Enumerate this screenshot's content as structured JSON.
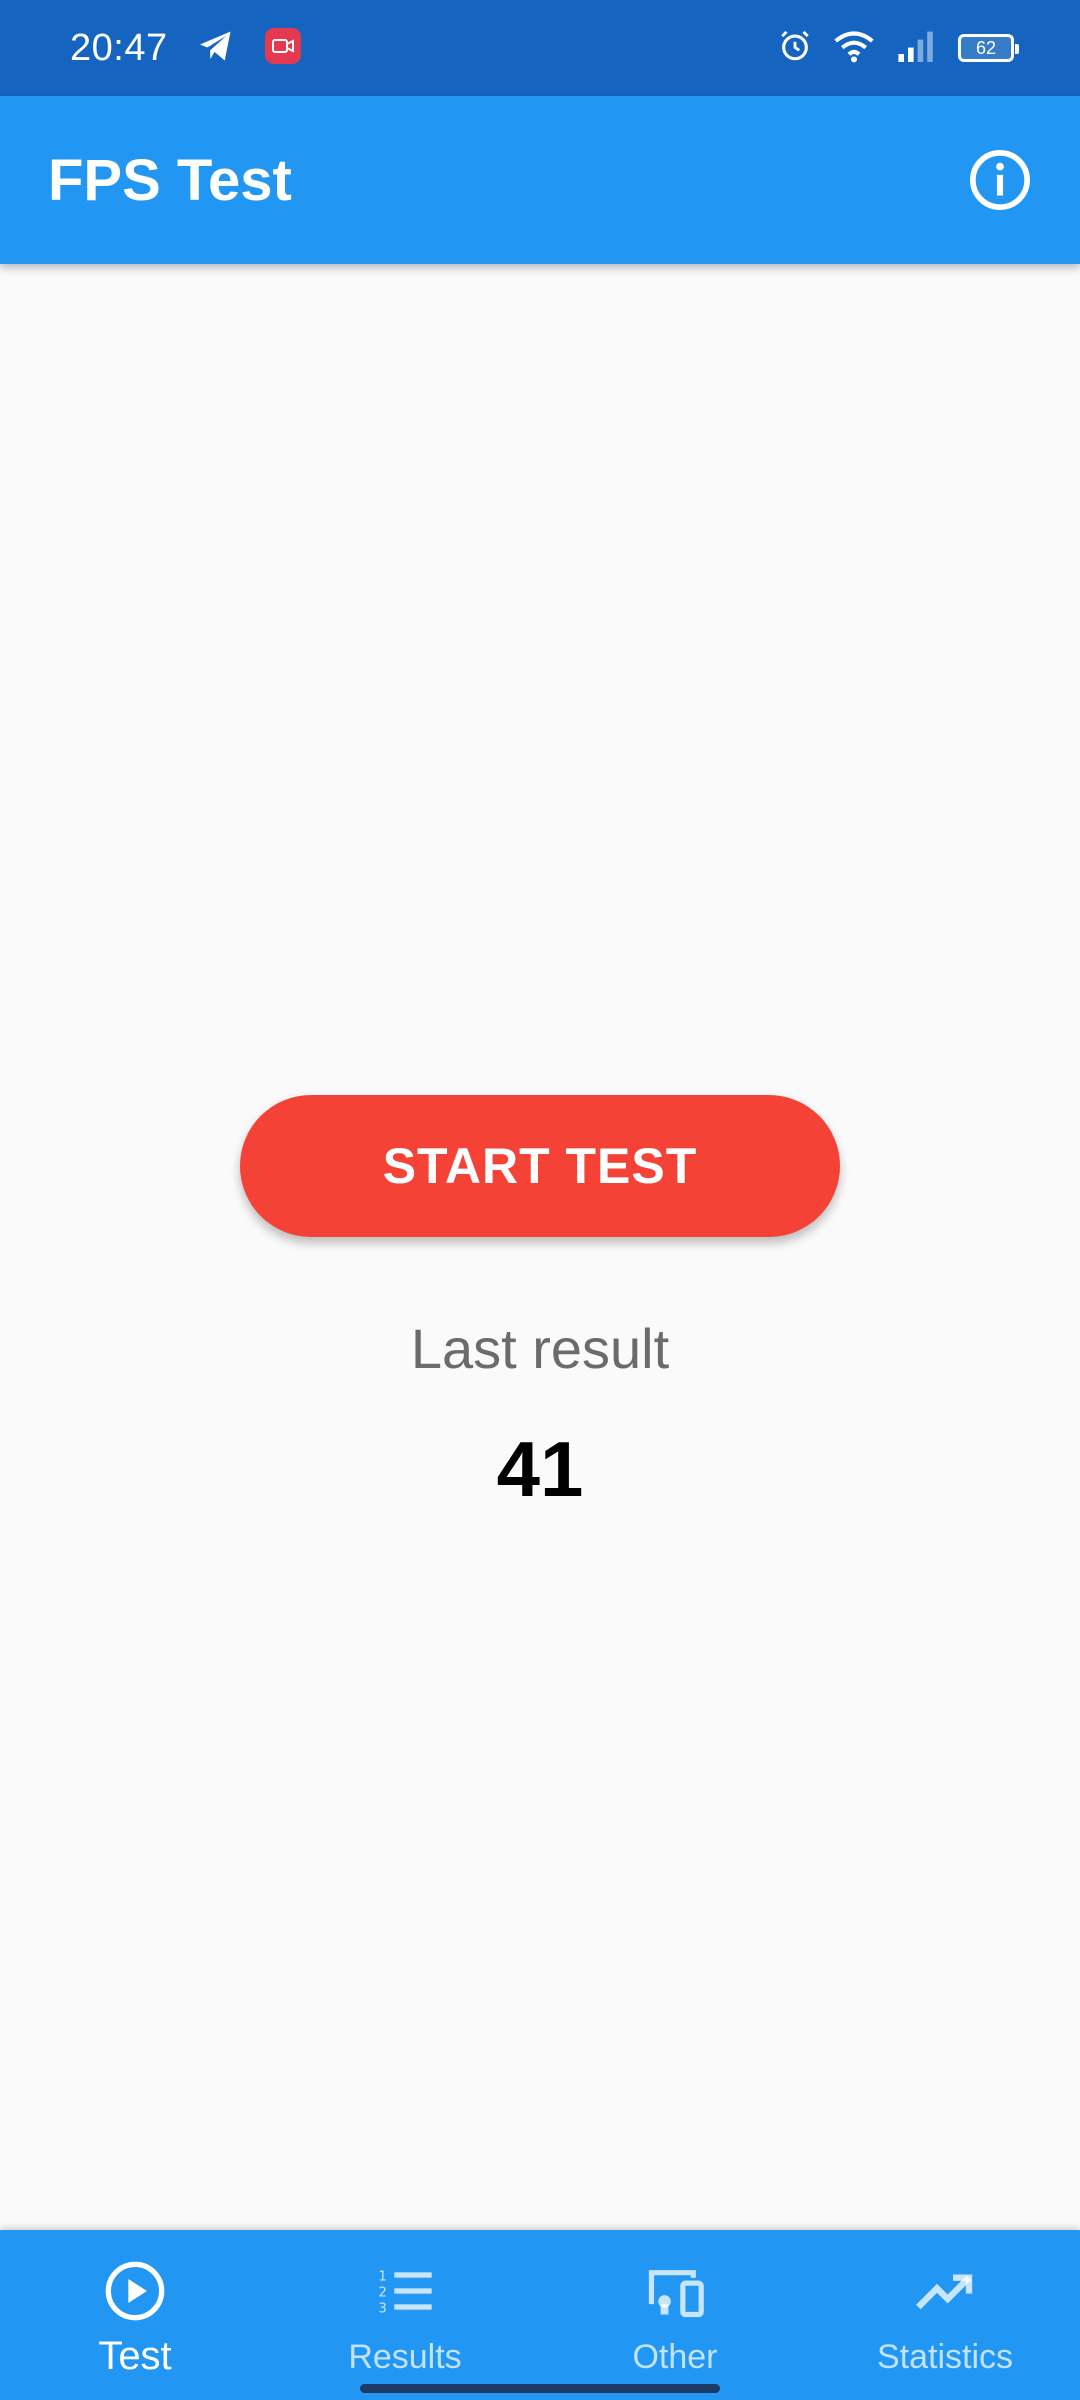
{
  "status_bar": {
    "time": "20:47",
    "battery": "62",
    "icons": [
      "telegram-icon",
      "screen-recorder-icon",
      "alarm-icon",
      "wifi-icon",
      "signal-icon",
      "battery-icon"
    ]
  },
  "app_bar": {
    "title": "FPS Test",
    "info_icon": "info-icon"
  },
  "main": {
    "start_button_label": "START TEST",
    "last_result_label": "Last result",
    "last_result_value": "41"
  },
  "bottom_nav": {
    "items": [
      {
        "label": "Test",
        "icon": "play-circle-icon",
        "active": true
      },
      {
        "label": "Results",
        "icon": "numbered-list-icon",
        "active": false
      },
      {
        "label": "Other",
        "icon": "devices-icon",
        "active": false
      },
      {
        "label": "Statistics",
        "icon": "trending-up-icon",
        "active": false
      }
    ]
  },
  "colors": {
    "status_bar": "#1565c0",
    "primary": "#2196f3",
    "accent": "#f44336",
    "background": "#fafafa"
  }
}
